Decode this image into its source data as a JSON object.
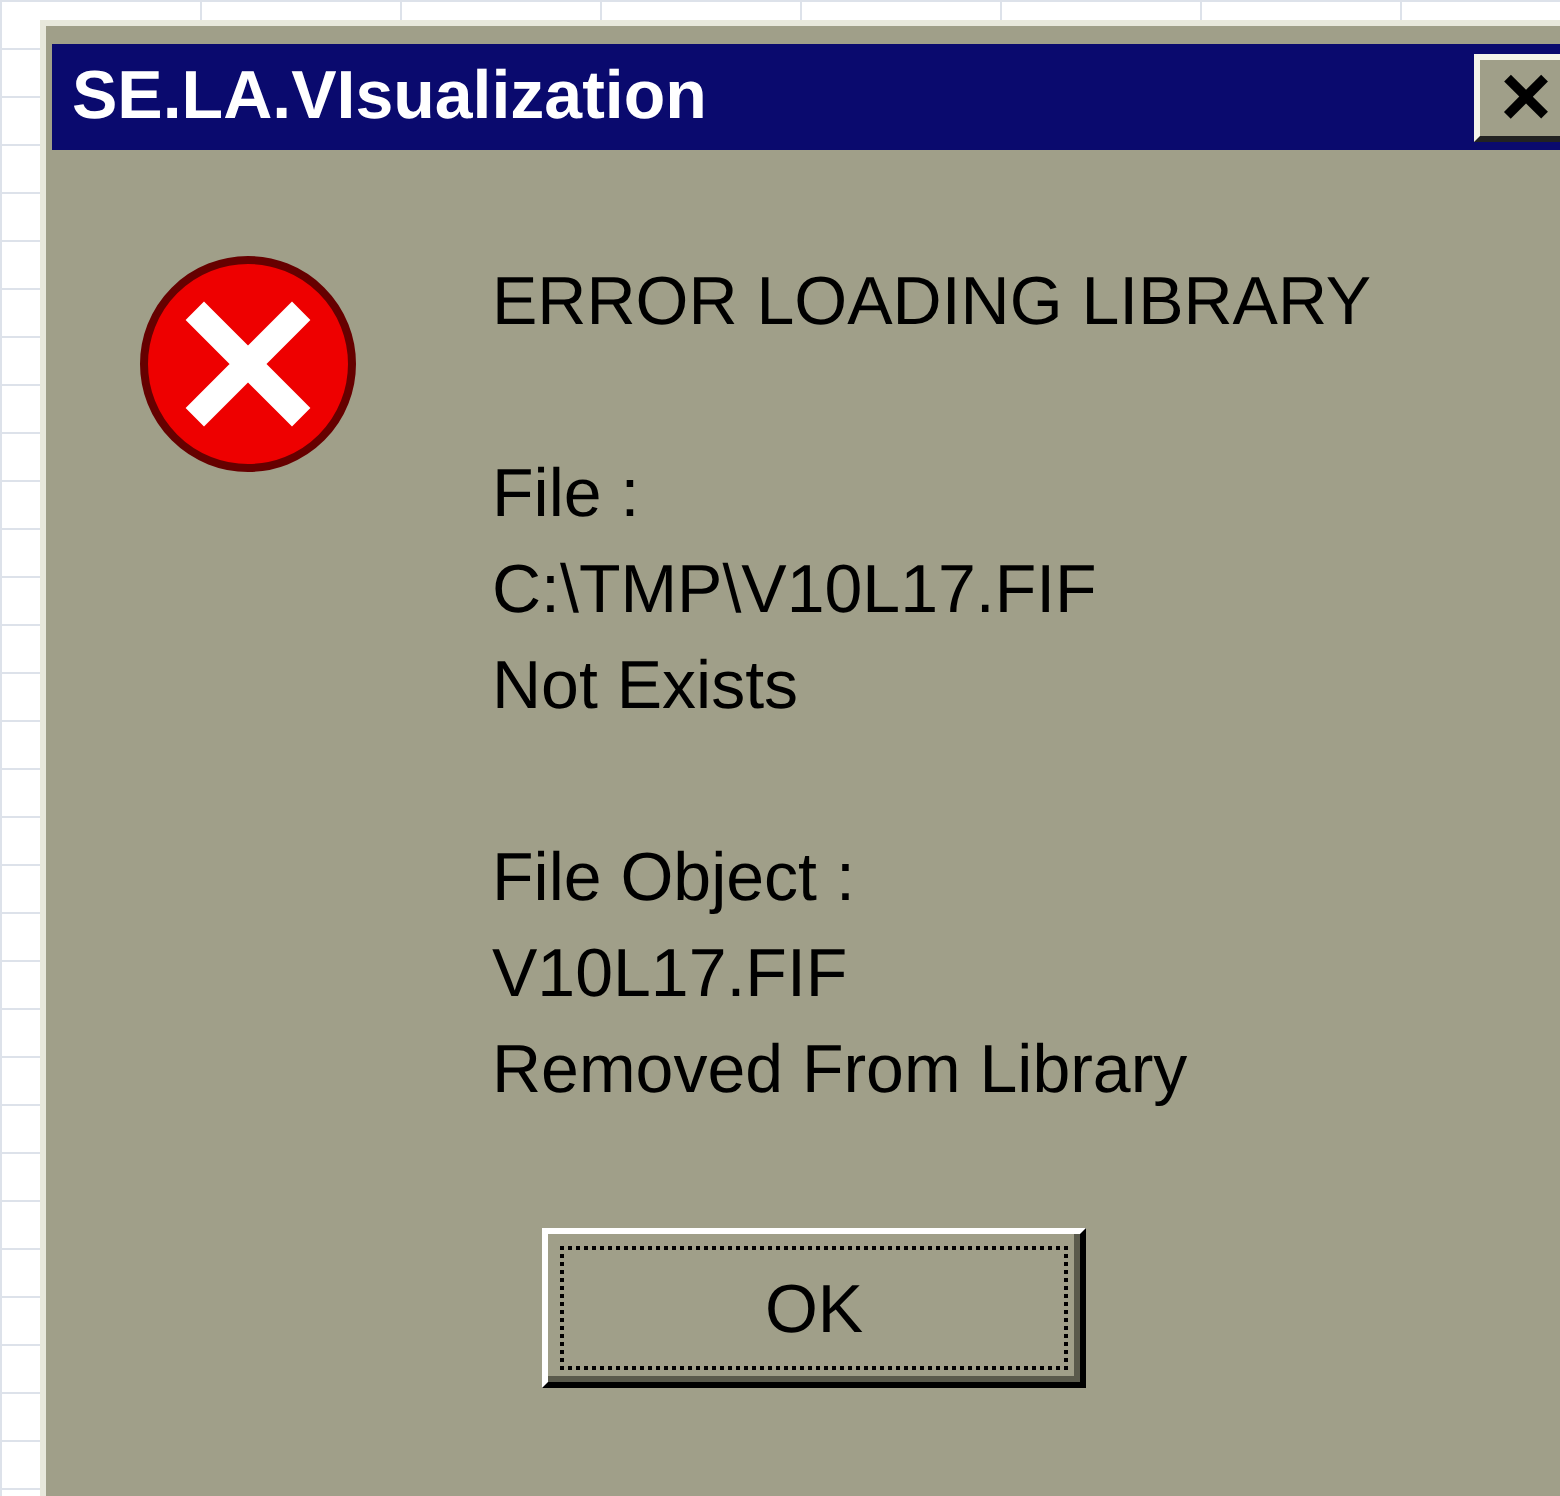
{
  "window": {
    "title": "SE.LA.VIsualization",
    "close": "×"
  },
  "message": {
    "heading": "ERROR LOADING LIBRARY",
    "blocks": [
      [
        "File :",
        "C:\\TMP\\V10L17.FIF",
        "Not Exists"
      ],
      [
        "File Object :",
        "V10L17.FIF",
        "Removed From Library"
      ]
    ]
  },
  "button": {
    "label": "OK",
    "focused": true
  }
}
